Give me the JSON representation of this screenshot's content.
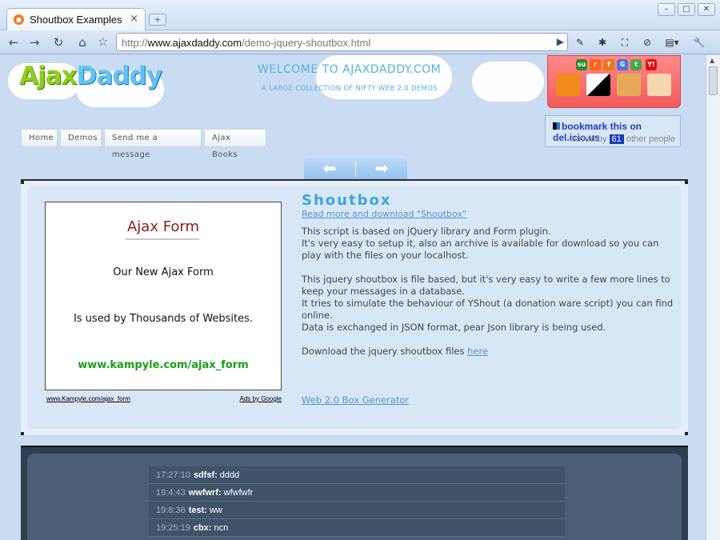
{
  "browser": {
    "tab_title": "Shoutbox Examples",
    "url_prefix": "http://",
    "url_host": "www.ajaxdaddy.com",
    "url_path": "/demo-jquery-shoutbox.html"
  },
  "header": {
    "logo_ajax": "Ajax",
    "logo_daddy": "Daddy",
    "welcome": "WELCOME TO AJAXDADDY.COM",
    "welcome_sub": "A LARGE COLLECTION OF NIFTY WEB 2.0 DEMOS"
  },
  "nav": {
    "items": [
      "Home",
      "Demos",
      "Send me a message",
      "Ajax Books"
    ]
  },
  "delicious": {
    "link": "bookmark this on del.icio.us",
    "saved_by": "saved by",
    "count": "61",
    "other_people": "other people"
  },
  "social_icons": [
    "stumbleupon-icon",
    "reddit-icon",
    "furl-icon",
    "google-icon",
    "technorati-icon",
    "yahoo-icon",
    "rss-icon",
    "delicious-icon",
    "digg-icon",
    "avatar-icon"
  ],
  "ad": {
    "title": "Ajax Form",
    "line2": "Our New Ajax Form",
    "line3": "Is used by Thousands of Websites.",
    "link": "www.kampyle.com/ajax_form",
    "footer_left": "www.Kampyle.com/ajax_form",
    "footer_right": "Ads by Google"
  },
  "content": {
    "heading": "Shoutbox",
    "readmore": "Read more and download \"Shoutbox\"",
    "p1": "This script is based on jQuery library and Form plugin.",
    "p2": "It's very easy to setup it, also an archive is available for download so you can play with the files on your localhost.",
    "p3": "This jquery shoutbox is file based, but it's very easy to write a few more lines to keep your messages in a database.",
    "p4": "It tries to simulate the behaviour of YShout (a donation ware script) you can find online.",
    "p5": "Data is exchanged in JSON format, pear Json library is being used.",
    "download_text": "Download the jquery shoutbox files ",
    "download_link": "here",
    "webgen": "Web 2.0 Box Generator"
  },
  "shouts": [
    {
      "time": "17:27:10",
      "user": "sdfsf:",
      "msg": "dddd"
    },
    {
      "time": "19:4:43",
      "user": "wwfwrf:",
      "msg": "wfwfwfr"
    },
    {
      "time": "19:8:36",
      "user": "test:",
      "msg": "ww"
    },
    {
      "time": "19:25:19",
      "user": "cbx:",
      "msg": "ncn"
    }
  ]
}
